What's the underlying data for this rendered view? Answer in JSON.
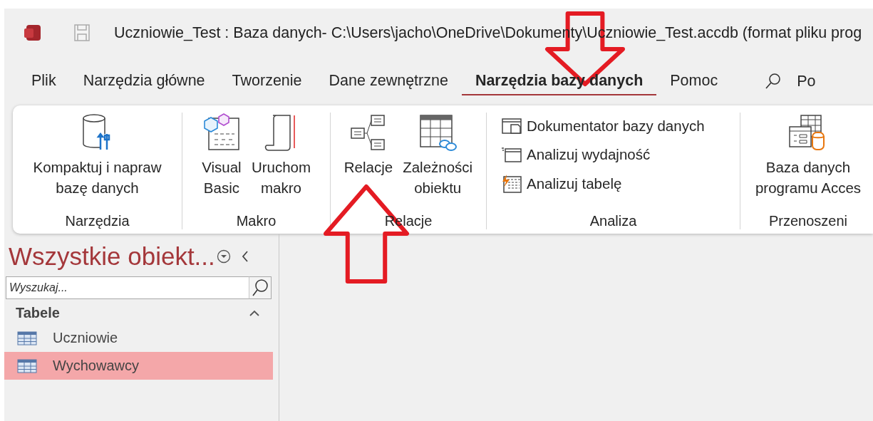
{
  "window": {
    "title": "Uczniowie_Test : Baza danych- C:\\Users\\jacho\\OneDrive\\Dokumenty\\Uczniowie_Test.accdb (format pliku prog"
  },
  "tabs": [
    {
      "label": "Plik",
      "selected": false
    },
    {
      "label": "Narzędzia główne",
      "selected": false
    },
    {
      "label": "Tworzenie",
      "selected": false
    },
    {
      "label": "Dane zewnętrzne",
      "selected": false
    },
    {
      "label": "Narzędzia bazy danych",
      "selected": true
    },
    {
      "label": "Pomoc",
      "selected": false
    }
  ],
  "tell_me": {
    "label": "Po"
  },
  "ribbon": {
    "groups": [
      {
        "label": "Narzędzia",
        "commands": [
          {
            "kind": "large",
            "label": "Kompaktuj i napraw\nbazę danych"
          }
        ]
      },
      {
        "label": "Makro",
        "commands": [
          {
            "kind": "large",
            "label": "Visual\nBasic"
          },
          {
            "kind": "large",
            "label": "Uruchom\nmakro"
          }
        ]
      },
      {
        "label": "Relacje",
        "commands": [
          {
            "kind": "large",
            "label": "Relacje"
          },
          {
            "kind": "large",
            "label": "Zależności\nobiektu"
          }
        ]
      },
      {
        "label": "Analiza",
        "commands": [
          {
            "kind": "small",
            "label": "Dokumentator bazy danych"
          },
          {
            "kind": "small",
            "label": "Analizuj wydajność"
          },
          {
            "kind": "small",
            "label": "Analizuj tabelę"
          }
        ]
      },
      {
        "label": "Przenoszeni",
        "commands": [
          {
            "kind": "large",
            "label": "Baza danych\nprogramu Acces"
          }
        ]
      }
    ]
  },
  "navigation_pane": {
    "title": "Wszystkie obiekt...",
    "search": {
      "placeholder": "Wyszukaj..."
    },
    "groups": [
      {
        "label": "Tabele",
        "expanded": true,
        "items": [
          {
            "label": "Uczniowie",
            "selected": false
          },
          {
            "label": "Wychowawcy",
            "selected": true
          }
        ]
      }
    ]
  },
  "annotations": [
    {
      "kind": "down-arrow"
    },
    {
      "kind": "up-arrow"
    }
  ]
}
